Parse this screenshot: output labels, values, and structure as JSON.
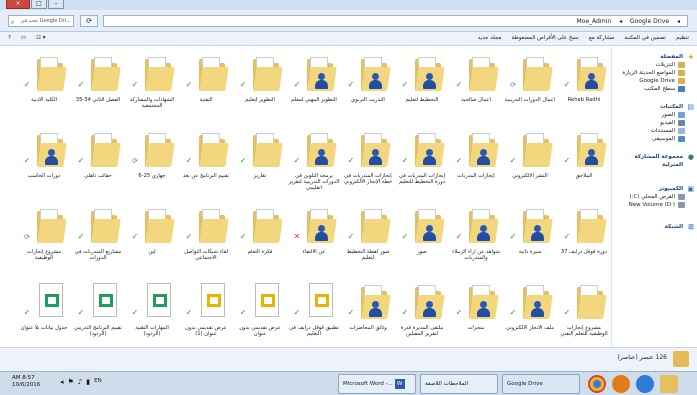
{
  "titlebar": {
    "buttons": [
      "×",
      "□",
      "–"
    ]
  },
  "address": {
    "search_placeholder": "بحث في Google Dri...",
    "crumbs": [
      "Google Drive",
      "Moe_Admin"
    ]
  },
  "toolbar": {
    "right": [
      "تنظيم",
      "تضمين في المكتبة",
      "مشاركة مع",
      "نسخ على الأقراص المضغوطة",
      "مجلد جديد"
    ]
  },
  "sidebar": {
    "favorites": {
      "title": "المفضلة",
      "items": [
        "التنزيلات",
        "المواضع الحديثة الزيارة",
        "Google Drive",
        "سطح المكتب"
      ]
    },
    "libraries": {
      "title": "المكتبات",
      "items": [
        "الصور",
        "الفيديو",
        "المستندات",
        "الموسيقى"
      ]
    },
    "homegroup": {
      "title": "مجموعة المشاركة المنزلية"
    },
    "computer": {
      "title": "الكمبيوتر",
      "items": [
        "القرص المحلي (C:)",
        "New Volume (D:)"
      ]
    },
    "network": {
      "title": "الشبكة"
    }
  },
  "files": [
    {
      "name": "Rehab Radhi",
      "kind": "folder-person",
      "status": "check"
    },
    {
      "name": "أعمال الدورات التدريبية",
      "kind": "folder",
      "status": "sync"
    },
    {
      "name": "أعمال صالحية",
      "kind": "folder",
      "status": "check"
    },
    {
      "name": "التخطيط لتعليم",
      "kind": "folder-person",
      "status": "check"
    },
    {
      "name": "التدريب التربوي",
      "kind": "folder-person",
      "status": "check"
    },
    {
      "name": "التطوير المهني لمعلم",
      "kind": "folder-person",
      "status": "check"
    },
    {
      "name": "التطوير لتعليم",
      "kind": "folder",
      "status": "check"
    },
    {
      "name": "التقنية",
      "kind": "folder",
      "status": "check"
    },
    {
      "name": "الشهادات والمشاركة المجتمعية",
      "kind": "folder",
      "status": "check"
    },
    {
      "name": "الفصل الثاني 34-35",
      "kind": "folder",
      "status": "check"
    },
    {
      "name": "الكلية الأدبية",
      "kind": "folder",
      "status": "check"
    },
    {
      "name": "الملاحق",
      "kind": "folder-person",
      "status": "check"
    },
    {
      "name": "النشر الالكتروني",
      "kind": "folder",
      "status": "check"
    },
    {
      "name": "إنجازات المدربات",
      "kind": "folder-person",
      "status": "check"
    },
    {
      "name": "إنجازات المدربات في دورة التخطيط للتعليم",
      "kind": "folder-person",
      "status": "check"
    },
    {
      "name": "إنجازات المتدربات في خطة الإنجاز الالكتروني",
      "kind": "folder-person",
      "status": "check"
    },
    {
      "name": "برمجة التلوين في الدورات التدريبية لتقرير اتقليمي",
      "kind": "folder-person",
      "status": "check"
    },
    {
      "name": "تقارير",
      "kind": "folder",
      "status": "check"
    },
    {
      "name": "تقييم البرنامج عن بعد",
      "kind": "folder",
      "status": "check"
    },
    {
      "name": "جهازي 25-6",
      "kind": "folder",
      "status": "sync"
    },
    {
      "name": "حقائب تأهلي",
      "kind": "folder",
      "status": "check"
    },
    {
      "name": "دورات الحاسب",
      "kind": "folder-person",
      "status": "check"
    },
    {
      "name": "دورة قوقل درايف 37",
      "kind": "folder",
      "status": "check"
    },
    {
      "name": "سيرة ذاتية",
      "kind": "folder-person",
      "status": "check"
    },
    {
      "name": "شواهد عن آراء الزملاء والمتدربات",
      "kind": "folder-person",
      "status": "check"
    },
    {
      "name": "صور",
      "kind": "folder-person",
      "status": "check"
    },
    {
      "name": "صور لقطة التخطيط لتعليم",
      "kind": "folder",
      "status": "check"
    },
    {
      "name": "عن الالتقاء",
      "kind": "folder-person",
      "status": "error"
    },
    {
      "name": "فكرة التعلم",
      "kind": "folder",
      "status": "check"
    },
    {
      "name": "لقاء شبكات التواصل الاجتماعي",
      "kind": "folder",
      "status": "check"
    },
    {
      "name": "لين",
      "kind": "folder",
      "status": "check"
    },
    {
      "name": "مشاريع المتدربات في الدورات",
      "kind": "folder",
      "status": "check"
    },
    {
      "name": "مشروع إنجازات الوظيفية",
      "kind": "folder",
      "status": "sync"
    },
    {
      "name": "مشروع إنجازات الوظيفية للتعلم التقني",
      "kind": "folder",
      "status": "check"
    },
    {
      "name": "ملف الانجاز الالكتروني",
      "kind": "folder-person",
      "status": "check"
    },
    {
      "name": "منجزات",
      "kind": "folder-person",
      "status": "check"
    },
    {
      "name": "ملتقى المديرة قدرة لتقرير المقبلين",
      "kind": "folder-person",
      "status": "check"
    },
    {
      "name": "وثائق المحاضرات",
      "kind": "folder-person",
      "status": "check"
    },
    {
      "name": "تطبيق قوقل درايف في التعليم",
      "kind": "slides",
      "status": "check"
    },
    {
      "name": "عرض تقديمي بدون عنوان",
      "kind": "slides",
      "status": "check"
    },
    {
      "name": "عرض تقديمي بدون عنوان (1)",
      "kind": "slides",
      "status": "check"
    },
    {
      "name": "المهارات التقنية (الردود)",
      "kind": "sheet",
      "status": "check"
    },
    {
      "name": "تقييم البرنامج التدريبي (الردود)",
      "kind": "sheet",
      "status": "check"
    },
    {
      "name": "جدول بيانات بلا عنوان",
      "kind": "sheet",
      "status": "check"
    }
  ],
  "status": {
    "count": "126 عنصر (عناصر)"
  },
  "taskbar": {
    "clock_time": "AM 8:57",
    "clock_date": "10/6/2016",
    "lang": "EN",
    "tasks": [
      "Microsoft Word -...",
      "الملاحظات اللاصقة",
      "Google Drive"
    ]
  },
  "colors": {
    "folder": "#e4c061",
    "accent": "#2658b8",
    "check": "#19a119"
  }
}
